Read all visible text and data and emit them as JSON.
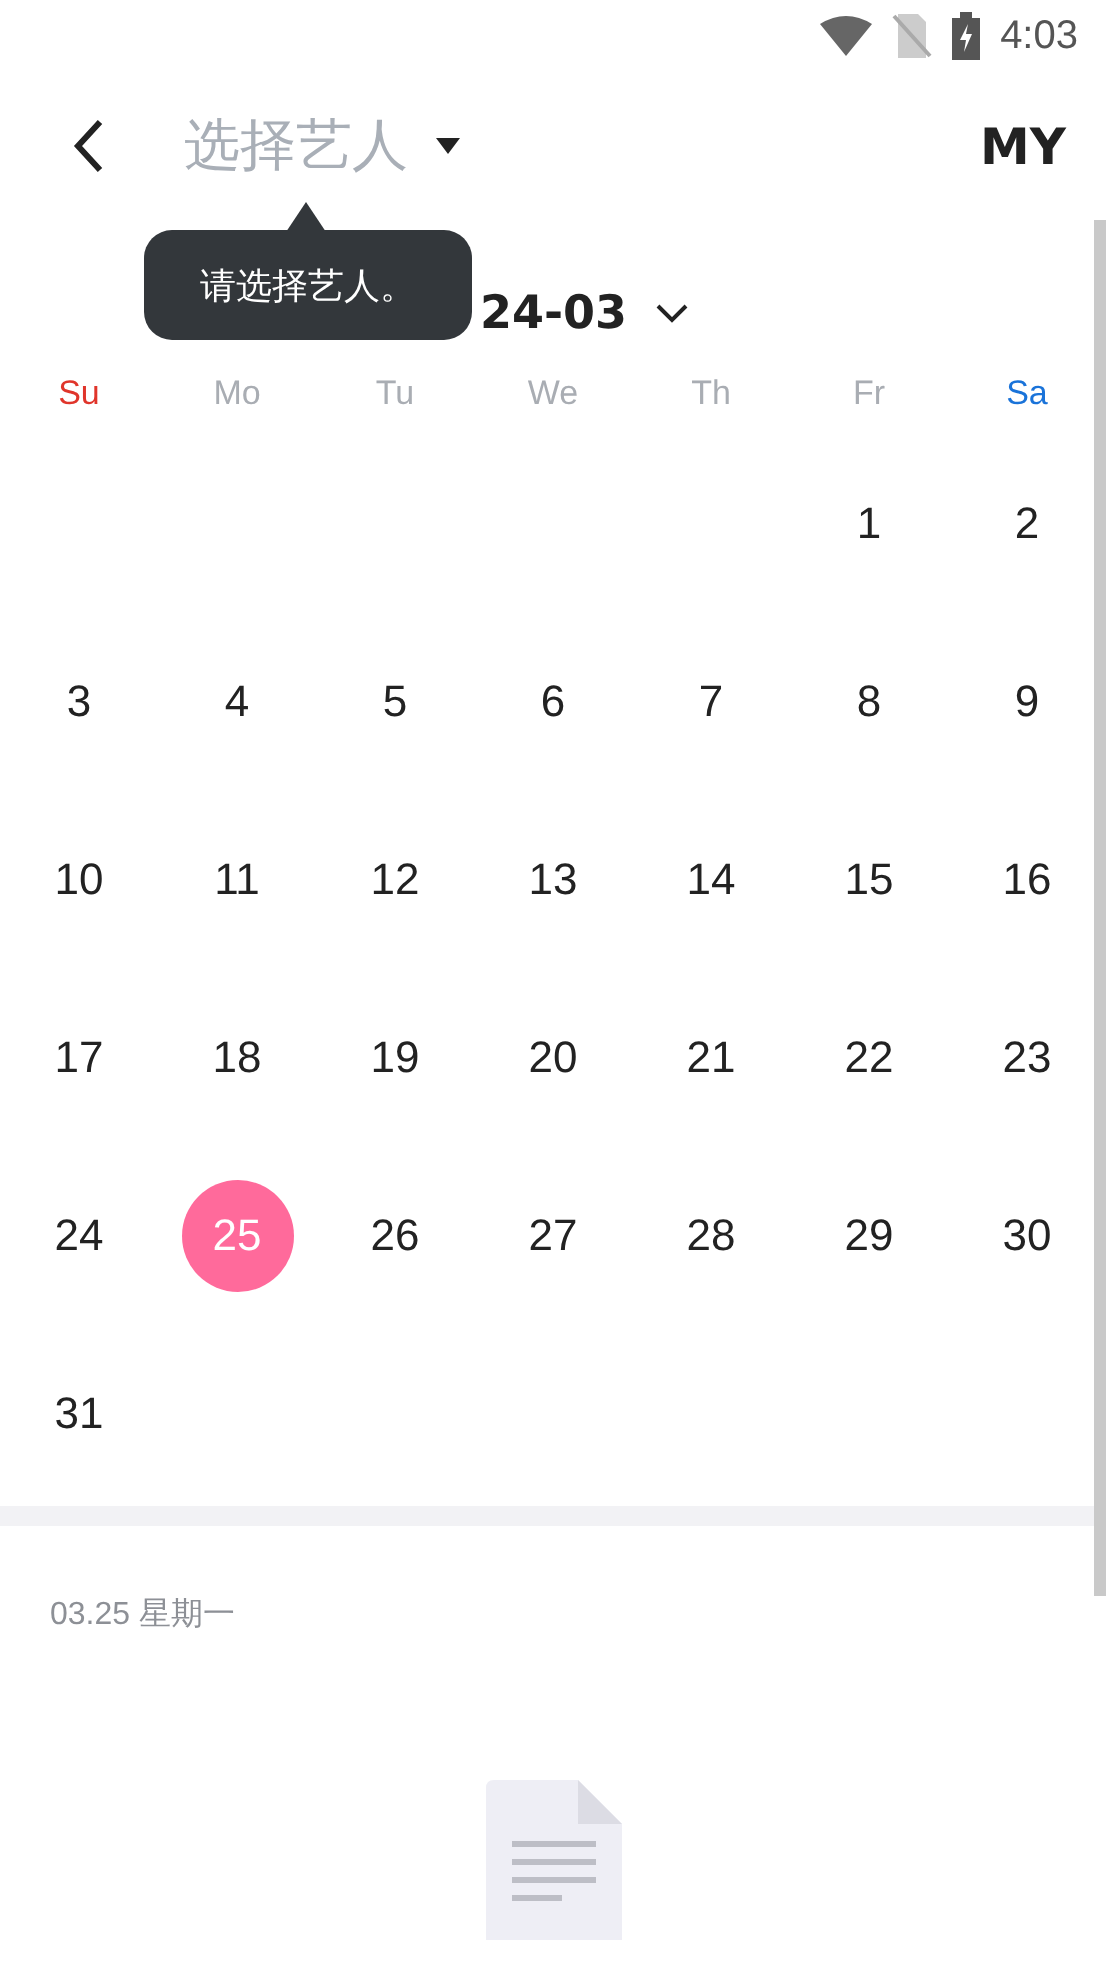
{
  "status_bar": {
    "time": "4:03"
  },
  "header": {
    "title": "选择艺人",
    "action": "MY"
  },
  "tooltip": {
    "text": "请选择艺人。"
  },
  "month_picker": {
    "label": "24-03"
  },
  "weekdays": [
    {
      "label": "Su",
      "color": "#e0352b"
    },
    {
      "label": "Mo",
      "color": "#a9adb3"
    },
    {
      "label": "Tu",
      "color": "#a9adb3"
    },
    {
      "label": "We",
      "color": "#a9adb3"
    },
    {
      "label": "Th",
      "color": "#a9adb3"
    },
    {
      "label": "Fr",
      "color": "#a9adb3"
    },
    {
      "label": "Sa",
      "color": "#1a73d9"
    }
  ],
  "weeks": [
    [
      {
        "label": "1",
        "selected": false
      },
      {
        "label": "2",
        "selected": false
      }
    ],
    [
      {
        "label": "3",
        "selected": false
      },
      {
        "label": "4",
        "selected": false
      },
      {
        "label": "5",
        "selected": false
      },
      {
        "label": "6",
        "selected": false
      },
      {
        "label": "7",
        "selected": false
      },
      {
        "label": "8",
        "selected": false
      },
      {
        "label": "9",
        "selected": false
      }
    ],
    [
      {
        "label": "10",
        "selected": false
      },
      {
        "label": "11",
        "selected": false
      },
      {
        "label": "12",
        "selected": false
      },
      {
        "label": "13",
        "selected": false
      },
      {
        "label": "14",
        "selected": false
      },
      {
        "label": "15",
        "selected": false
      },
      {
        "label": "16",
        "selected": false
      }
    ],
    [
      {
        "label": "17",
        "selected": false
      },
      {
        "label": "18",
        "selected": false
      },
      {
        "label": "19",
        "selected": false
      },
      {
        "label": "20",
        "selected": false
      },
      {
        "label": "21",
        "selected": false
      },
      {
        "label": "22",
        "selected": false
      },
      {
        "label": "23",
        "selected": false
      }
    ],
    [
      {
        "label": "24",
        "selected": false
      },
      {
        "label": "25",
        "selected": true
      },
      {
        "label": "26",
        "selected": false
      },
      {
        "label": "27",
        "selected": false
      },
      {
        "label": "28",
        "selected": false
      },
      {
        "label": "29",
        "selected": false
      },
      {
        "label": "30",
        "selected": false
      }
    ],
    [
      {
        "label": "31",
        "selected": false
      }
    ]
  ],
  "day_detail": {
    "date": "03.25 星期一"
  }
}
